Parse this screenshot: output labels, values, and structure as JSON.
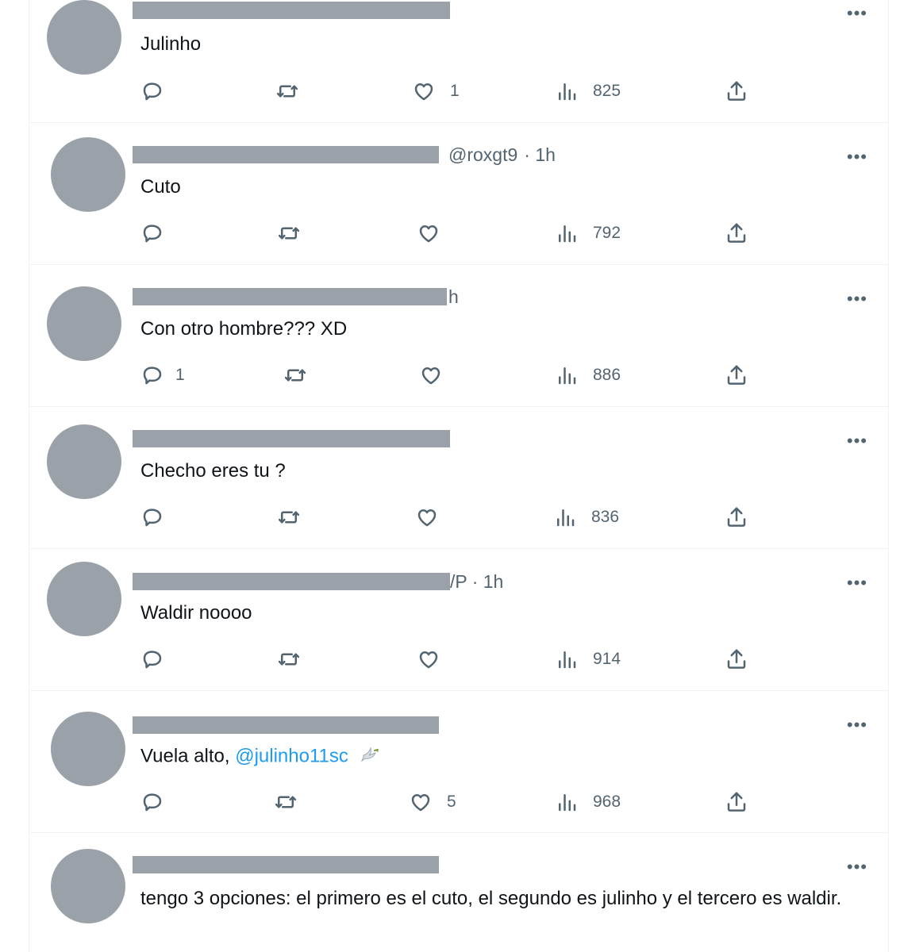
{
  "icons": {
    "reply": "reply-icon",
    "retweet": "retweet-icon",
    "like": "heart-icon",
    "views": "views-icon",
    "share": "share-icon",
    "more": "more-icon",
    "emoji": "dove-emoji"
  },
  "colors": {
    "link": "#1d9bf0",
    "muted": "#536471",
    "redaction": "#9aa1a9"
  },
  "more_label": "•••",
  "tweets": [
    {
      "handle": "",
      "time": "",
      "text": "Julinho",
      "replies": "",
      "likes": "1",
      "views": "825"
    },
    {
      "handle": "@roxgt9",
      "time": "· 1h",
      "text": "Cuto",
      "replies": "",
      "likes": "",
      "views": "792"
    },
    {
      "handle": "",
      "time": "h",
      "text": "Con otro hombre??? XD",
      "replies": "1",
      "likes": "",
      "views": "886"
    },
    {
      "handle": "",
      "time": "",
      "text": "Checho eres tu ?",
      "replies": "",
      "likes": "",
      "views": "836"
    },
    {
      "handle": "",
      "time": "/P · 1h",
      "text": "Waldir noooo",
      "replies": "",
      "likes": "",
      "views": "914"
    },
    {
      "handle": "",
      "time": "",
      "text_prefix": "Vuela alto, ",
      "mention": "@julinho11sc",
      "replies": "",
      "likes": "5",
      "views": "968"
    },
    {
      "handle": "",
      "time": "",
      "text": "tengo 3 opciones: el primero es el cuto, el segundo es julinho y el tercero es waldir.",
      "replies": "",
      "likes": "",
      "views": ""
    }
  ]
}
